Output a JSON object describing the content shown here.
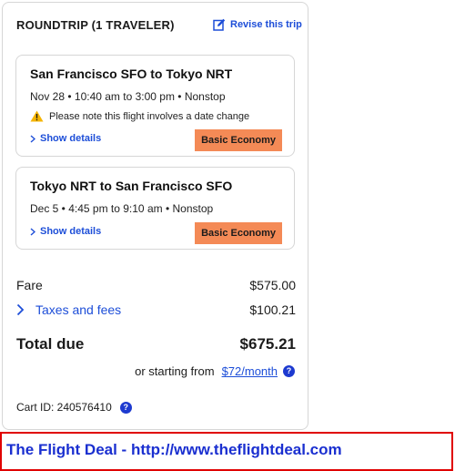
{
  "header": {
    "title": "ROUNDTRIP (1 TRAVELER)",
    "revise_label": "Revise this trip"
  },
  "segments": [
    {
      "route": "San Francisco SFO to Tokyo NRT",
      "time": "Nov 28 • 10:40 am to 3:00 pm • Nonstop",
      "note": "Please note this flight involves a date change",
      "details_label": "Show details",
      "fare_class": "Basic Economy"
    },
    {
      "route": "Tokyo NRT to San Francisco SFO",
      "time": "Dec 5 • 4:45 pm to 9:10 am • Nonstop",
      "details_label": "Show details",
      "fare_class": "Basic Economy"
    }
  ],
  "pricing": {
    "fare_label": "Fare",
    "fare_value": "$575.00",
    "taxes_label": "Taxes and fees",
    "taxes_value": "$100.21",
    "total_label": "Total due",
    "total_value": "$675.21",
    "monthly_prefix": "or starting from",
    "monthly_link": "$72/month"
  },
  "cart": {
    "id_text": "Cart ID: 240576410"
  },
  "banner": {
    "text": "The Flight Deal - http://www.theflightdeal.com"
  },
  "colors": {
    "link": "#1d4ed8",
    "badge": "#f48a56",
    "warning": "#f5b400",
    "banner_border": "#e00000",
    "banner_text": "#1a2fd0"
  },
  "icons": {
    "revise": "edit-icon",
    "warning": "warning-icon",
    "expand": "chevron-right-icon",
    "help": "question-icon"
  }
}
